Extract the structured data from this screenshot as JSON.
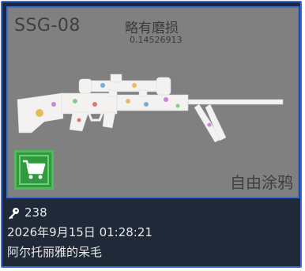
{
  "item": {
    "weapon_name": "SSG-08",
    "wear_label": "略有磨损",
    "wear_value": "0.14526913",
    "skin_name": "自由涂鸦",
    "key_count": "238",
    "timestamp": "2026年9月15日 01:28:21",
    "owner": "阿尔托丽雅的呆毛"
  },
  "icons": {
    "cart": "shopping-cart-icon",
    "key": "key-icon"
  },
  "colors": {
    "card_bg": "#202938",
    "preview_bg": "#808080",
    "accent_border": "#3b6fd6",
    "buy_button": "#2f9a3e"
  }
}
